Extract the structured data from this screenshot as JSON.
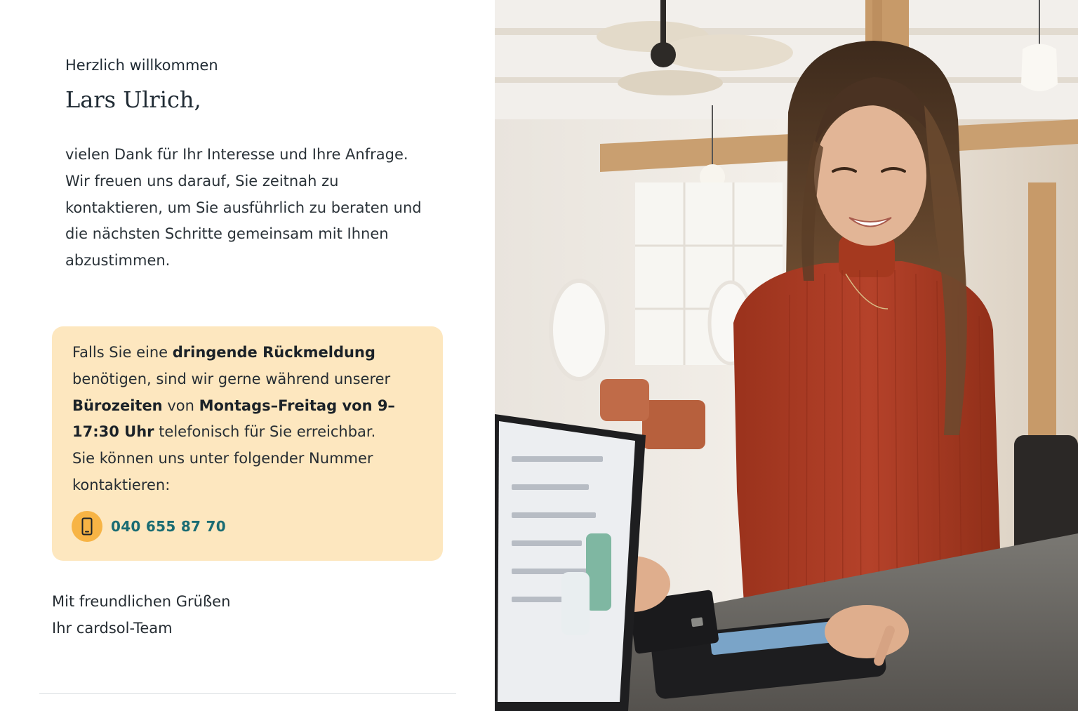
{
  "greeting": {
    "welcome": "Herzlich willkommen",
    "name": "Lars Ulrich,"
  },
  "message": {
    "paragraph_1": "vielen Dank für Ihr Interesse und Ihre Anfrage.",
    "paragraph_2": "Wir freuen uns darauf, Sie zeitnah zu kontaktieren, um Sie ausführlich zu beraten und die nächsten Schritte gemeinsam mit Ihnen abzustimmen."
  },
  "callout": {
    "t1": "Falls Sie eine ",
    "b1": "dringende Rückmeldung",
    "t2": " benötigen, sind wir gerne während unserer ",
    "b2": "Bürozeiten",
    "t3": " von ",
    "b3": "Montags–Freitag von 9–17:30 Uhr",
    "t4": " telefonisch für Sie erreichbar.",
    "t5": "Sie können uns unter folgender Nummer kontaktieren:",
    "phone_icon": "smartphone-icon",
    "phone_number": "040 655 87 70"
  },
  "signoff": {
    "line_1": "Mit freundlichen Grüßen",
    "line_2": "Ihr cardsol-Team"
  },
  "photo": {
    "subject": "woman-paying-with-card-at-terminal"
  },
  "colors": {
    "callout_bg": "#fde7bf",
    "icon_circle": "#f7b445",
    "phone_text": "#1a6c73",
    "sweater": "#a7381f"
  }
}
